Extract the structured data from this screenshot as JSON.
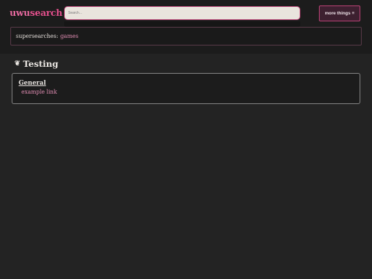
{
  "header": {
    "logo_uwu": "uwu",
    "logo_search": "search",
    "search_placeholder": "Search...",
    "more_label": "more things",
    "more_icon": "≡"
  },
  "supersearches": {
    "label": "supersearches:",
    "items": [
      "games"
    ]
  },
  "section": {
    "icon": "❦",
    "title": "Testing",
    "cards": [
      {
        "heading": "General",
        "links": [
          "example link"
        ]
      }
    ]
  },
  "colors": {
    "accent": "#c2447a",
    "link": "#e58fb6",
    "background": "#232323"
  }
}
